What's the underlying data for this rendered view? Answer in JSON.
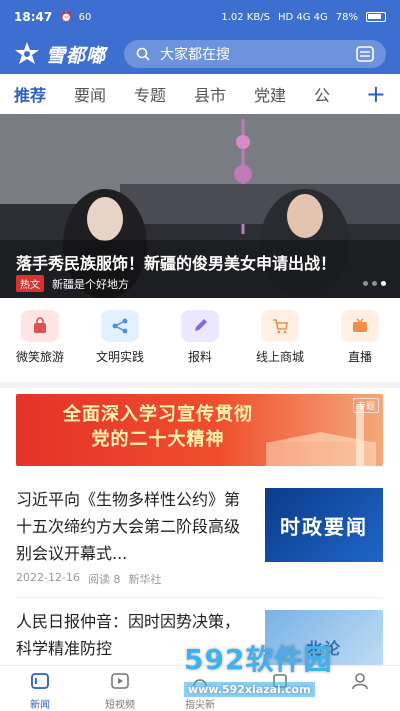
{
  "status": {
    "time": "18:47",
    "left_badges": [
      "60",
      "N"
    ],
    "net_speed": "1.02 KB/S",
    "signal": "HD 4G 4G",
    "battery": "78%"
  },
  "header": {
    "app_name": "雪都嘟",
    "search_placeholder": "大家都在搜"
  },
  "tabs": [
    "推荐",
    "要闻",
    "专题",
    "县市",
    "党建",
    "公"
  ],
  "banner": {
    "title": "落手秀民族服饰！新疆的俊男美女申请出战！",
    "tag": "热文",
    "source": "新疆是个好地方"
  },
  "quick_links": [
    {
      "label": "微笑旅游",
      "icon": "bag-icon",
      "color": "#ffe5e5",
      "fg": "#e05252",
      "glyph": "👜"
    },
    {
      "label": "文明实践",
      "icon": "share-icon",
      "color": "#e3f0ff",
      "fg": "#4a90e2",
      "glyph": "<"
    },
    {
      "label": "报料",
      "icon": "pencil-icon",
      "color": "#ece8ff",
      "fg": "#7a6ee0",
      "glyph": "✎"
    },
    {
      "label": "线上商城",
      "icon": "cart-icon",
      "color": "#fff0e3",
      "fg": "#f0904a",
      "glyph": "🛒"
    },
    {
      "label": "直播",
      "icon": "tv-icon",
      "color": "#fff0e3",
      "fg": "#f0904a",
      "glyph": "📺"
    }
  ],
  "promo": {
    "line1": "全面深入学习宣传贯彻",
    "line2": "党的二十大精神",
    "tag": "专题"
  },
  "news": [
    {
      "title": "习近平向《生物多样性公约》第十五次缔约方大会第二阶段高级别会议开幕式...",
      "date": "2022-12-16",
      "reads": "阅读 8",
      "source": "新华社",
      "thumb_text": "时政要闻"
    },
    {
      "title": "人民日报仲音：因时因势决策，科学精准防控",
      "date": "",
      "reads": "",
      "source": "",
      "thumb_text": "北论"
    }
  ],
  "tabbar": [
    {
      "label": "新闻",
      "icon": "news-icon"
    },
    {
      "label": "短视频",
      "icon": "video-icon"
    },
    {
      "label": "指尖新",
      "icon": "finger-icon"
    },
    {
      "label": "",
      "icon": "service-icon"
    },
    {
      "label": "",
      "icon": "user-icon"
    }
  ],
  "watermark": {
    "big": "592软件园",
    "small": "www.592xiazai.com"
  }
}
